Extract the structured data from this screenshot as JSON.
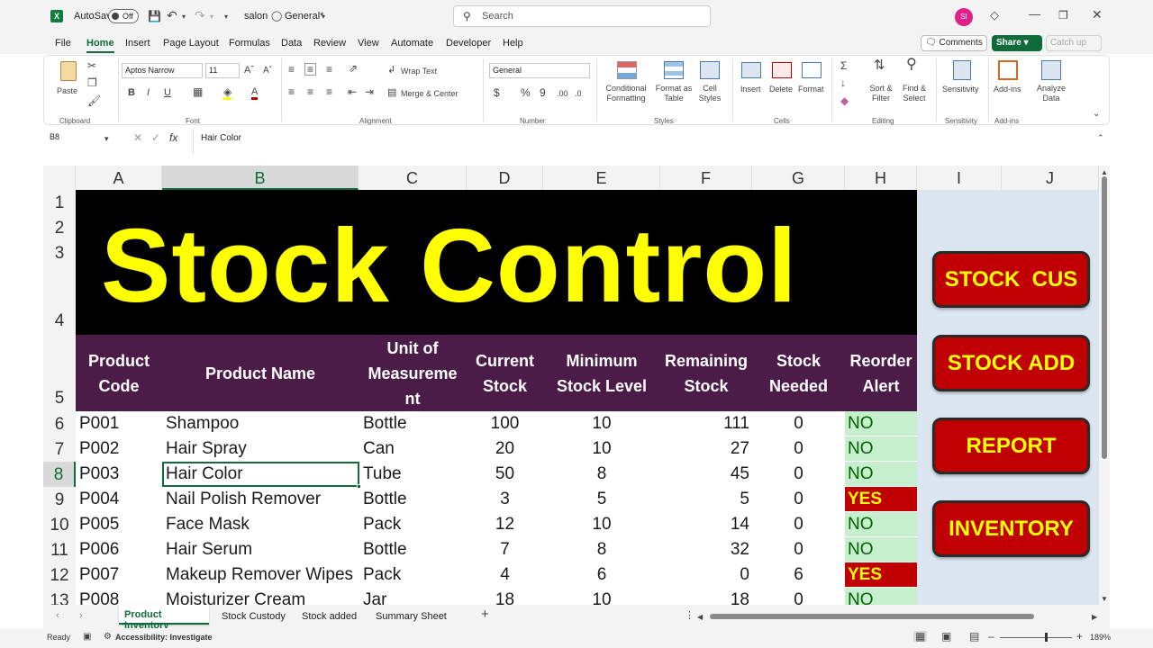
{
  "titlebar": {
    "autosave_label": "AutoSave",
    "autosave_state": "Off",
    "filename": "salon",
    "sensitivity": "General*",
    "search_placeholder": "Search",
    "avatar_initials": "SI"
  },
  "menu": [
    "File",
    "Home",
    "Insert",
    "Page Layout",
    "Formulas",
    "Data",
    "Review",
    "View",
    "Automate",
    "Developer",
    "Help"
  ],
  "menu_right": {
    "comments": "Comments",
    "share": "Share",
    "catchup": "Catch up"
  },
  "ribbon": {
    "clipboard": {
      "paste": "Paste",
      "group": "Clipboard"
    },
    "font": {
      "name": "Aptos Narrow",
      "size": "11",
      "group": "Font"
    },
    "alignment": {
      "wrap": "Wrap Text",
      "merge": "Merge & Center",
      "group": "Alignment"
    },
    "number": {
      "format": "General",
      "group": "Number"
    },
    "styles": {
      "conditional": "Conditional Formatting",
      "format_table": "Format as Table",
      "cell_styles": "Cell Styles",
      "group": "Styles"
    },
    "cells": {
      "insert": "Insert",
      "delete": "Delete",
      "format": "Format",
      "group": "Cells"
    },
    "editing": {
      "sort": "Sort & Filter",
      "find": "Find & Select",
      "group": "Editing"
    },
    "sensitivity": {
      "label": "Sensitivity",
      "group": "Sensitivity"
    },
    "addins": {
      "label": "Add-ins",
      "group": "Add-ins"
    },
    "analyze": {
      "label": "Analyze Data"
    }
  },
  "formula_bar": {
    "name_box": "B8",
    "fx": "fx",
    "content": "Hair Color"
  },
  "columns": [
    "A",
    "B",
    "C",
    "D",
    "E",
    "F",
    "G",
    "H",
    "I",
    "J"
  ],
  "rows": [
    "1",
    "2",
    "3",
    "4",
    "5",
    "6",
    "7",
    "8",
    "9",
    "10",
    "11",
    "12",
    "13"
  ],
  "sheet_title": "Stock Control",
  "table_headers": {
    "code": [
      "Product",
      "Code"
    ],
    "name": [
      "Product Name"
    ],
    "unit": [
      "Unit of",
      "Measureme",
      "nt"
    ],
    "current": [
      "Current",
      "Stock"
    ],
    "minimum": [
      "Minimum",
      "Stock Level"
    ],
    "remaining": [
      "Remaining",
      "Stock"
    ],
    "needed": [
      "Stock",
      "Needed"
    ],
    "alert": [
      "Reorder",
      "Alert"
    ]
  },
  "table_rows": [
    {
      "code": "P001",
      "name": "Shampoo",
      "unit": "Bottle",
      "current": "100",
      "minimum": "10",
      "remaining": "111",
      "needed": "0",
      "alert": "NO"
    },
    {
      "code": "P002",
      "name": "Hair Spray",
      "unit": "Can",
      "current": "20",
      "minimum": "10",
      "remaining": "27",
      "needed": "0",
      "alert": "NO"
    },
    {
      "code": "P003",
      "name": "Hair Color",
      "unit": "Tube",
      "current": "50",
      "minimum": "8",
      "remaining": "45",
      "needed": "0",
      "alert": "NO"
    },
    {
      "code": "P004",
      "name": "Nail Polish Remover",
      "unit": "Bottle",
      "current": "3",
      "minimum": "5",
      "remaining": "5",
      "needed": "0",
      "alert": "YES"
    },
    {
      "code": "P005",
      "name": "Face Mask",
      "unit": "Pack",
      "current": "12",
      "minimum": "10",
      "remaining": "14",
      "needed": "0",
      "alert": "NO"
    },
    {
      "code": "P006",
      "name": "Hair Serum",
      "unit": "Bottle",
      "current": "7",
      "minimum": "8",
      "remaining": "32",
      "needed": "0",
      "alert": "NO"
    },
    {
      "code": "P007",
      "name": "Makeup Remover Wipes",
      "unit": "Pack",
      "current": "4",
      "minimum": "6",
      "remaining": "0",
      "needed": "6",
      "alert": "YES"
    },
    {
      "code": "P008",
      "name": "Moisturizer Cream",
      "unit": "Jar",
      "current": "18",
      "minimum": "10",
      "remaining": "18",
      "needed": "0",
      "alert": "NO"
    }
  ],
  "side_buttons": [
    "STOCK  CUS",
    "STOCK ADD",
    "REPORT",
    "INVENTORY"
  ],
  "sheet_tabs": [
    "Product Inventory",
    "Stock Custody",
    "Stock added",
    "Summary Sheet"
  ],
  "status": {
    "ready": "Ready",
    "accessibility": "Accessibility: Investigate",
    "zoom": "189%"
  },
  "colors": {
    "title_bg": "#000000",
    "title_text": "#ffff00",
    "header_bg": "#4b1c48",
    "panel_bg": "#dce6f1",
    "no_bg": "#c6efce",
    "yes_bg": "#c00000",
    "yes_text": "#ffff00",
    "button_bg": "#c00000",
    "excel_green": "#0f6b3b"
  }
}
